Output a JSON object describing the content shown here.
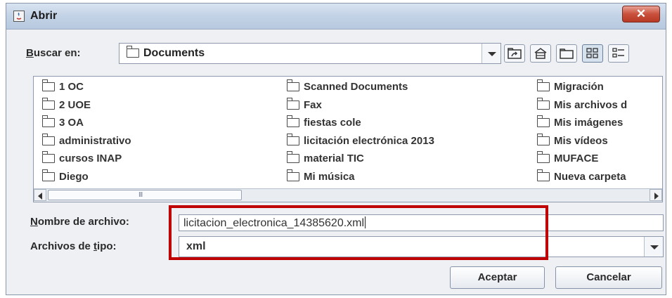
{
  "window": {
    "title": "Abrir",
    "close_glyph": "✕"
  },
  "look_in": {
    "label_prefix": "",
    "label_underlined": "B",
    "label_rest": "uscar en:",
    "value": "Documents"
  },
  "toolbar": {
    "icons": [
      "up-folder-icon",
      "home-icon",
      "new-folder-icon",
      "list-view-icon",
      "details-view-icon"
    ]
  },
  "files": {
    "column1": [
      "1 OC",
      "2 UOE",
      "3 OA",
      "administrativo",
      "cursos INAP",
      "Diego"
    ],
    "column2": [
      "Scanned Documents",
      "Fax",
      "fiestas cole",
      "licitación electrónica 2013",
      "material TIC",
      "Mi música"
    ],
    "column3": [
      "Migración",
      "Mis archivos d",
      "Mis imágenes",
      "Mis vídeos",
      "MUFACE",
      "Nueva carpeta"
    ]
  },
  "scroll_grip": "III",
  "file_name": {
    "label_underlined": "N",
    "label_rest": "ombre de archivo:",
    "value": "licitacion_electronica_14385620.xml"
  },
  "file_type": {
    "label_prefix": "Archivos de ",
    "label_underlined": "t",
    "label_rest": "ipo:",
    "value": "xml"
  },
  "buttons": {
    "ok": "Aceptar",
    "cancel": "Cancelar"
  },
  "colors": {
    "highlight": "#c00000",
    "title_bar": "#c4d3e6",
    "close": "#c9503c"
  }
}
